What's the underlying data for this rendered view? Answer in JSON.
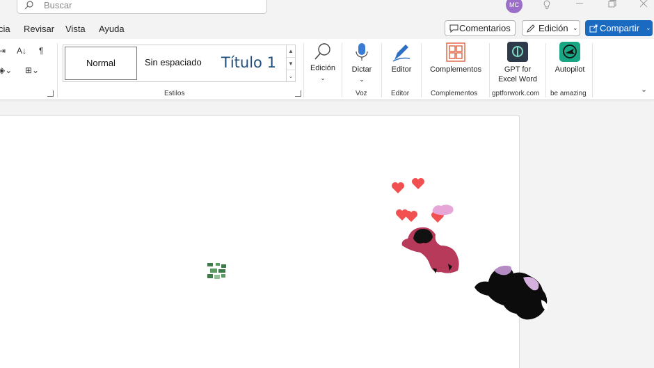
{
  "titlebar": {
    "search_placeholder": "Buscar",
    "avatar_initials": "MC"
  },
  "menu": {
    "items": [
      "cia",
      "Revisar",
      "Vista",
      "Ayuda"
    ]
  },
  "actions": {
    "comments": "Comentarios",
    "editing": "Edición",
    "share": "Compartir"
  },
  "ribbon": {
    "styles": {
      "normal": "Normal",
      "sin_espaciado": "Sin espaciado",
      "titulo1": "Título 1",
      "group_label": "Estilos"
    },
    "edicion": {
      "label": "Edición"
    },
    "voz": {
      "button": "Dictar",
      "group_label": "Voz"
    },
    "editor": {
      "button": "Editor",
      "group_label": "Editor"
    },
    "complementos": {
      "button": "Complementos",
      "group_label": "Complementos"
    },
    "gpt": {
      "line1": "GPT for",
      "line2": "Excel Word",
      "group_label": "gptforwork.com"
    },
    "autopilot": {
      "button": "Autopilot",
      "group_label": "be amazing"
    }
  },
  "colors": {
    "accent": "#1a6ac2",
    "heart": "#f25050",
    "blob_red": "#b83a5a",
    "blob_purple": "#b58bc4",
    "blob_green": "#3f7a4a",
    "gpt_icon": "#2c3a4a",
    "autopilot_icon": "#19a685",
    "complementos_icon": "#e06a4a"
  }
}
